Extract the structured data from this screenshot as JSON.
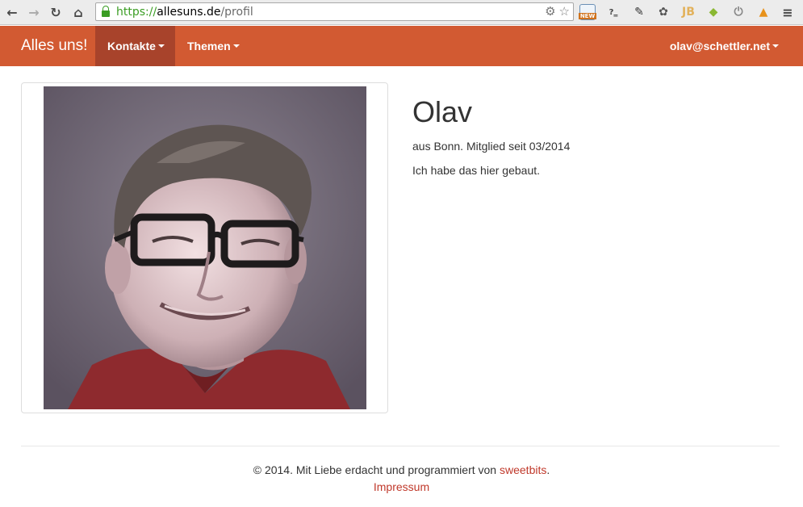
{
  "browser": {
    "url_protocol": "https://",
    "url_host": "allesuns.de",
    "url_path": "/profil",
    "extension_badge": "NEW",
    "extension_jb": "JB"
  },
  "navbar": {
    "brand": "Alles uns!",
    "items": [
      {
        "label": "Kontakte",
        "active": true
      },
      {
        "label": "Themen",
        "active": false
      }
    ],
    "user_menu": "olav@schettler.net",
    "color": "#d25a32",
    "active_color": "#a8432b"
  },
  "profile": {
    "name": "Olav",
    "meta": "aus Bonn. Mitglied seit 03/2014",
    "bio": "Ich habe das hier gebaut."
  },
  "footer": {
    "text_prefix": "© 2014. Mit Liebe erdacht und programmiert von ",
    "link": "sweetbits",
    "text_suffix": ".",
    "impressum": "Impressum",
    "link_color": "#c0392b"
  }
}
